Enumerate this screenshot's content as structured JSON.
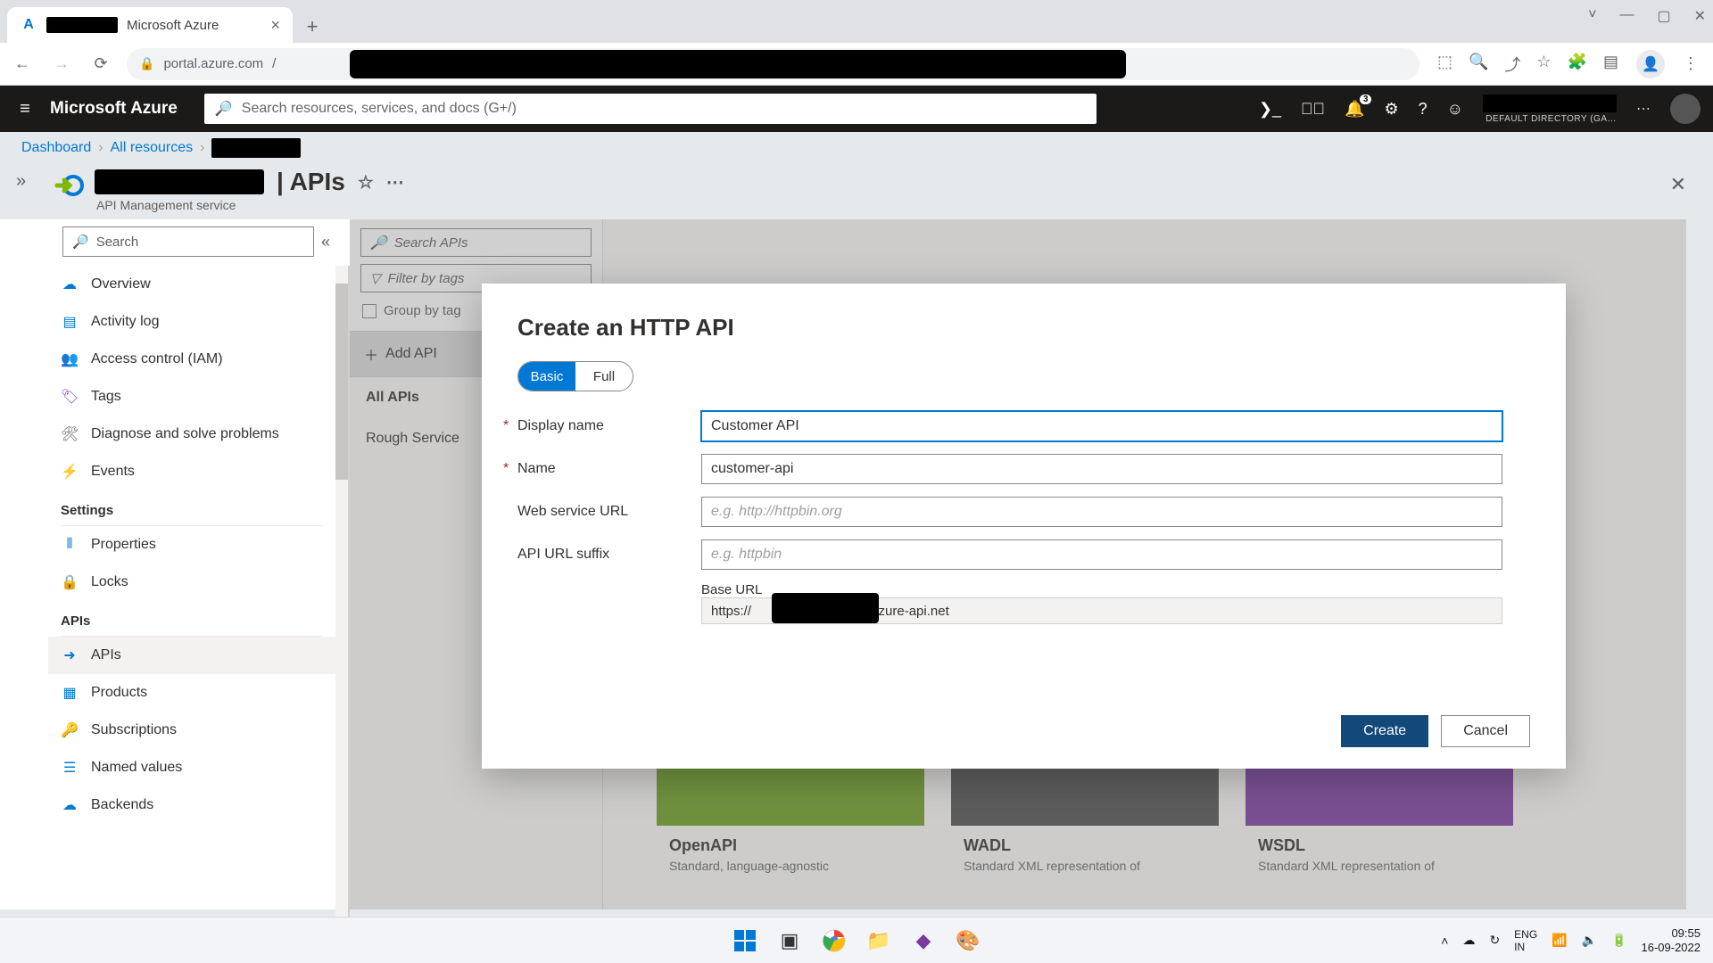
{
  "browser": {
    "tab_title": "Microsoft Azure",
    "url_host": "portal.azure.com",
    "new_tab_glyph": "+"
  },
  "azure": {
    "brand": "Microsoft Azure",
    "search_placeholder": "Search resources, services, and docs (G+/)",
    "notifications_badge": "3",
    "tenant": "DEFAULT DIRECTORY (GA…"
  },
  "breadcrumb": {
    "items": [
      "Dashboard",
      "All resources"
    ]
  },
  "blade": {
    "title_suffix": "| APIs",
    "subtitle": "API Management service"
  },
  "leftnav": {
    "search_placeholder": "Search",
    "groups": {
      "settings": "Settings",
      "apis": "APIs"
    },
    "items": {
      "overview": "Overview",
      "activity": "Activity log",
      "iam": "Access control (IAM)",
      "tags": "Tags",
      "diagnose": "Diagnose and solve problems",
      "events": "Events",
      "properties": "Properties",
      "locks": "Locks",
      "apis": "APIs",
      "products": "Products",
      "subscriptions": "Subscriptions",
      "namedvalues": "Named values",
      "backends": "Backends"
    }
  },
  "apilist": {
    "search_placeholder": "Search APIs",
    "filter_placeholder": "Filter by tags",
    "group_label": "Group by tag",
    "add_api": "Add API",
    "all_apis": "All APIs",
    "rough": "Rough Service"
  },
  "gallery": {
    "openapi": {
      "title": "OpenAPI",
      "sub": "Standard, language-agnostic"
    },
    "wadl": {
      "title": "WADL",
      "sub": "Standard XML representation of"
    },
    "wsdl": {
      "title": "WSDL",
      "sub": "Standard XML representation of"
    }
  },
  "modal": {
    "title": "Create an HTTP API",
    "tab_basic": "Basic",
    "tab_full": "Full",
    "labels": {
      "display_name": "Display name",
      "name": "Name",
      "web_url": "Web service URL",
      "suffix": "API URL suffix",
      "base_url": "Base URL"
    },
    "values": {
      "display_name": "Customer API",
      "name": "customer-api",
      "web_url_placeholder": "e.g. http://httpbin.org",
      "suffix_placeholder": "e.g. httpbin",
      "base_url_prefix": "https://",
      "base_url_suffix": ".azure-api.net"
    },
    "buttons": {
      "create": "Create",
      "cancel": "Cancel"
    }
  },
  "taskbar": {
    "lang1": "ENG",
    "lang2": "IN",
    "time": "09:55",
    "date": "16-09-2022"
  }
}
